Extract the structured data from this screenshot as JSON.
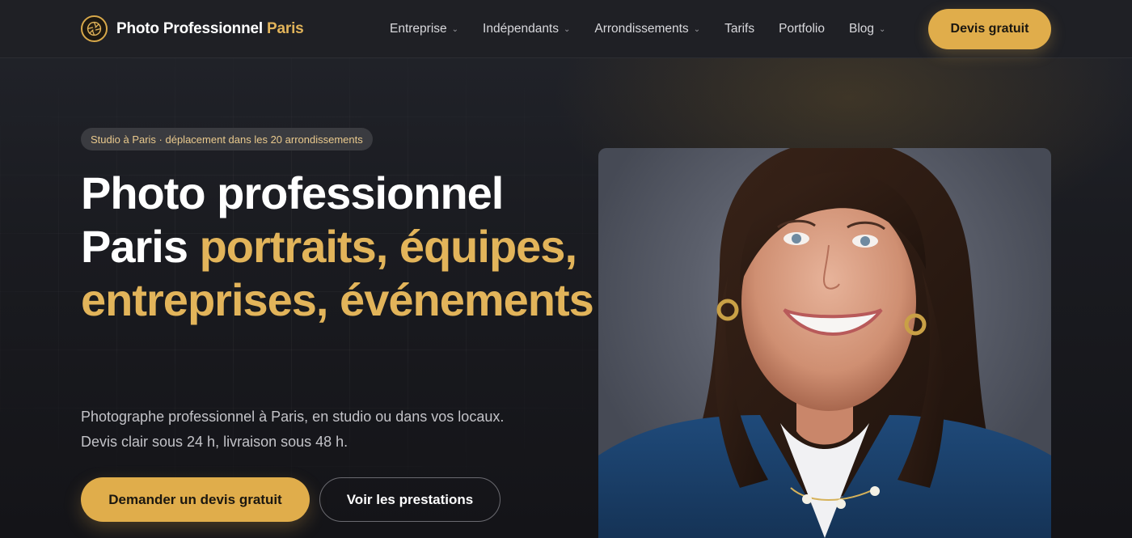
{
  "header": {
    "brand": {
      "name": "Photo Professionnel",
      "accent": "Paris"
    },
    "nav": [
      {
        "label": "Entreprise",
        "has_dropdown": true
      },
      {
        "label": "Indépendants",
        "has_dropdown": true
      },
      {
        "label": "Arrondissements",
        "has_dropdown": true
      },
      {
        "label": "Tarifs",
        "has_dropdown": false
      },
      {
        "label": "Portfolio",
        "has_dropdown": false
      },
      {
        "label": "Blog",
        "has_dropdown": true
      }
    ],
    "cta_label": "Devis gratuit"
  },
  "hero": {
    "badge": "Studio à Paris · déplacement dans les 20 arrondissements",
    "title_white": "Photo professionnel Paris",
    "title_gold": "portraits, équipes, entreprises, événements",
    "lede_line1": "Photographe professionnel à Paris, en studio ou dans vos locaux.",
    "lede_line2": "Devis clair sous 24 h, livraison sous 48 h.",
    "primary_button": "Demander un devis gratuit",
    "secondary_button": "Voir les prestations"
  },
  "colors": {
    "accent": "#e0ad4b",
    "accent_text": "#e2b45a",
    "background": "#16171b",
    "header_bg": "#1f2025"
  },
  "icons": {
    "logo": "camera-aperture-icon",
    "dropdown": "chevron-down-icon"
  }
}
